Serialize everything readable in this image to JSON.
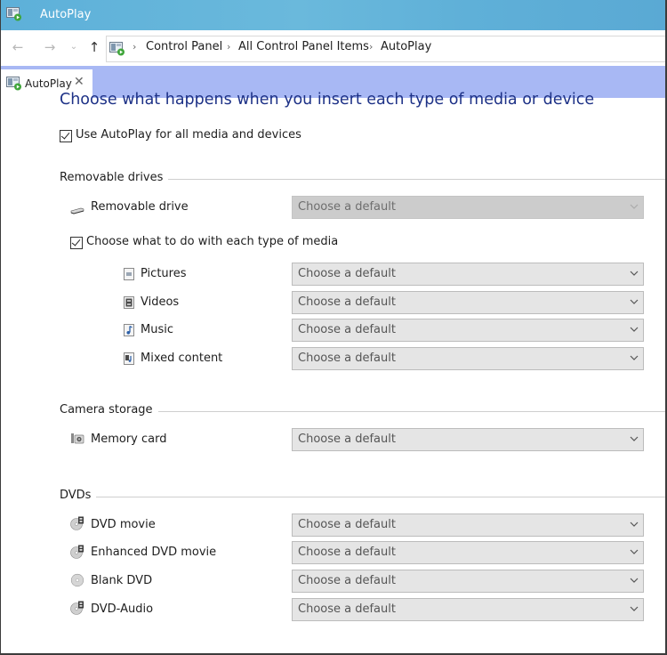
{
  "window": {
    "title": "AutoPlay",
    "accent_color": "#5db0d9",
    "tab_strip_color": "#a8b8f4"
  },
  "nav": {
    "back_icon": "←",
    "forward_icon": "→",
    "recent_icon": "⌄",
    "up_icon": "↑",
    "breadcrumb": [
      "Control Panel",
      "All Control Panel Items",
      "AutoPlay"
    ],
    "separator": "›"
  },
  "tab": {
    "label": "AutoPlay",
    "close_icon": "✕"
  },
  "main": {
    "heading": "Choose what happens when you insert each type of media or device",
    "use_autoplay": {
      "label": "Use AutoPlay for all media and devices",
      "checked": true
    },
    "groups": [
      {
        "title": "Removable drives",
        "items": [
          {
            "label": "Removable drive",
            "icon": "removable-drive-icon",
            "value": "Choose a default",
            "disabled": true
          }
        ],
        "media_toggle": {
          "label": "Choose what to do with each type of media",
          "checked": true
        },
        "media_items": [
          {
            "label": "Pictures",
            "icon": "pictures-icon",
            "value": "Choose a default"
          },
          {
            "label": "Videos",
            "icon": "videos-icon",
            "value": "Choose a default"
          },
          {
            "label": "Music",
            "icon": "music-icon",
            "value": "Choose a default"
          },
          {
            "label": "Mixed content",
            "icon": "mixed-content-icon",
            "value": "Choose a default"
          }
        ]
      },
      {
        "title": "Camera storage",
        "items": [
          {
            "label": "Memory card",
            "icon": "memory-card-icon",
            "value": "Choose a default"
          }
        ]
      },
      {
        "title": "DVDs",
        "items": [
          {
            "label": "DVD movie",
            "icon": "dvd-movie-icon",
            "value": "Choose a default"
          },
          {
            "label": "Enhanced DVD movie",
            "icon": "enhanced-dvd-movie-icon",
            "value": "Choose a default"
          },
          {
            "label": "Blank DVD",
            "icon": "blank-dvd-icon",
            "value": "Choose a default"
          },
          {
            "label": "DVD-Audio",
            "icon": "dvd-audio-icon",
            "value": "Choose a default"
          }
        ]
      }
    ]
  }
}
